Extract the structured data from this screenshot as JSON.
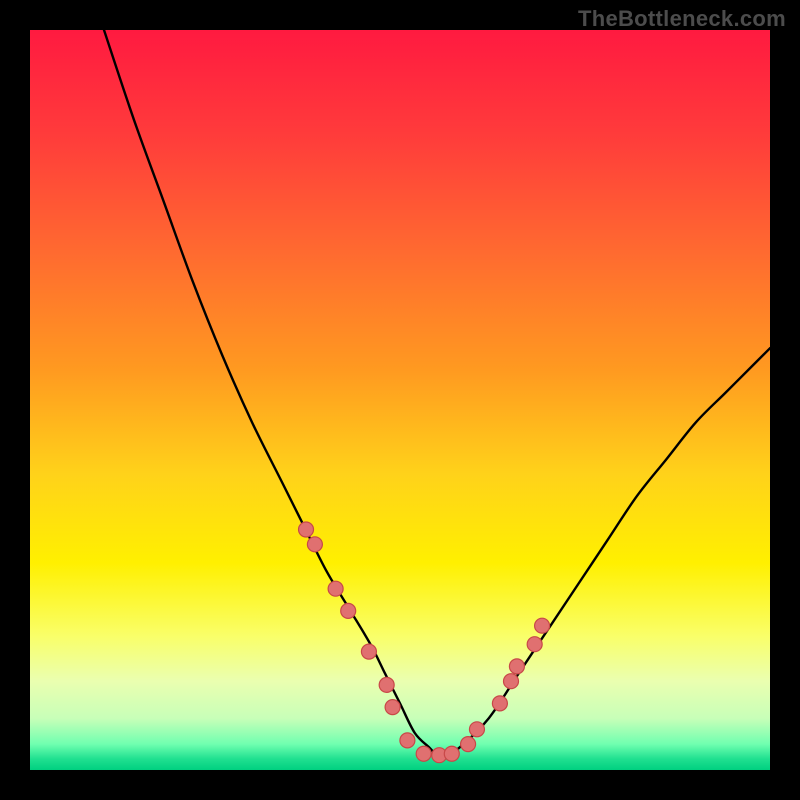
{
  "watermark": "TheBottleneck.com",
  "colors": {
    "frame": "#000000",
    "curve": "#000000",
    "dot_fill": "#e07070",
    "dot_stroke": "#c84848",
    "gradient_stops": [
      {
        "offset": 0.0,
        "color": "#ff1a40"
      },
      {
        "offset": 0.14,
        "color": "#ff3b3b"
      },
      {
        "offset": 0.3,
        "color": "#ff6a30"
      },
      {
        "offset": 0.46,
        "color": "#ff9a20"
      },
      {
        "offset": 0.6,
        "color": "#ffd21a"
      },
      {
        "offset": 0.72,
        "color": "#fff000"
      },
      {
        "offset": 0.82,
        "color": "#f9ff6a"
      },
      {
        "offset": 0.88,
        "color": "#eaffb0"
      },
      {
        "offset": 0.93,
        "color": "#c8ffb8"
      },
      {
        "offset": 0.965,
        "color": "#70ffb0"
      },
      {
        "offset": 0.985,
        "color": "#20e090"
      },
      {
        "offset": 1.0,
        "color": "#00d080"
      }
    ]
  },
  "chart_data": {
    "type": "line",
    "title": "",
    "xlabel": "",
    "ylabel": "",
    "xlim": [
      0,
      100
    ],
    "ylim": [
      0,
      100
    ],
    "series": [
      {
        "name": "curve",
        "x": [
          10,
          14,
          18,
          22,
          26,
          30,
          34,
          37,
          40,
          43,
          46,
          48,
          50,
          52,
          54,
          55,
          56,
          58,
          62,
          66,
          70,
          74,
          78,
          82,
          86,
          90,
          94,
          98,
          100
        ],
        "y": [
          100,
          88,
          77,
          66,
          56,
          47,
          39,
          33,
          27,
          22,
          17,
          13,
          9,
          5,
          3,
          2,
          2,
          3,
          7,
          13,
          19,
          25,
          31,
          37,
          42,
          47,
          51,
          55,
          57
        ]
      }
    ],
    "points": {
      "name": "markers",
      "x": [
        37.3,
        38.5,
        41.3,
        43.0,
        45.8,
        48.2,
        49.0,
        51.0,
        53.2,
        55.3,
        57.0,
        59.2,
        60.4,
        63.5,
        65.0,
        65.8,
        68.2,
        69.2
      ],
      "y": [
        32.5,
        30.5,
        24.5,
        21.5,
        16.0,
        11.5,
        8.5,
        4.0,
        2.2,
        2.0,
        2.2,
        3.5,
        5.5,
        9.0,
        12.0,
        14.0,
        17.0,
        19.5
      ]
    }
  }
}
